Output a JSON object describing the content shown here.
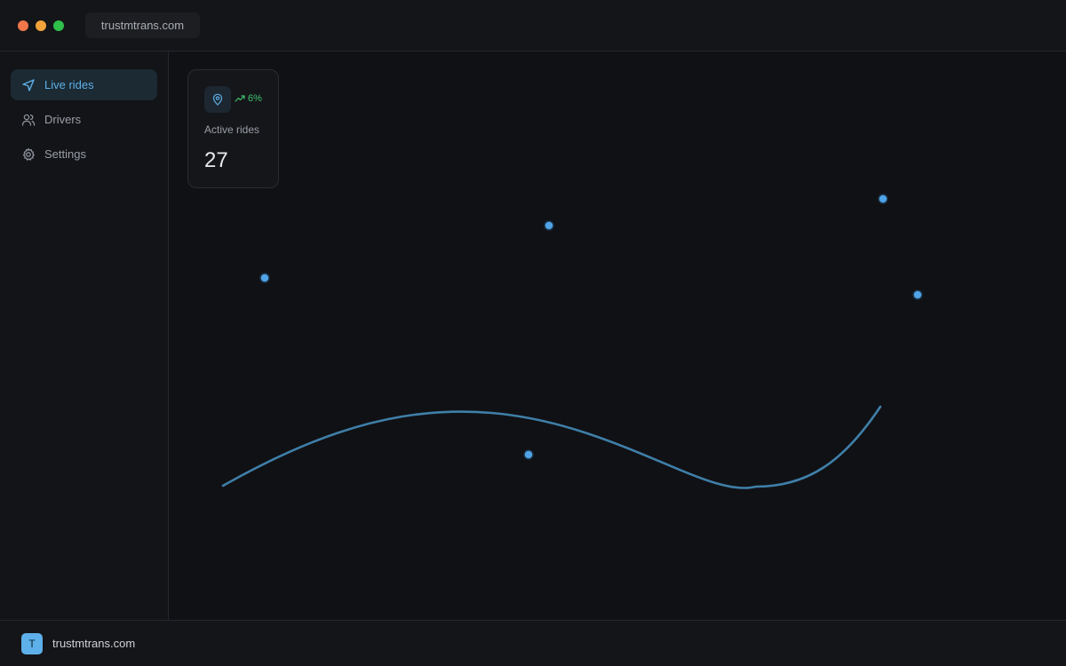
{
  "window": {
    "url": "trustmtrans.com"
  },
  "sidebar": {
    "items": [
      {
        "label": "Live rides",
        "icon": "navigation-arrow-icon",
        "active": true
      },
      {
        "label": "Drivers",
        "icon": "users-icon",
        "active": false
      },
      {
        "label": "Settings",
        "icon": "gear-icon",
        "active": false
      }
    ]
  },
  "stat_card": {
    "icon": "map-pin-icon",
    "trend": "6%",
    "trend_direction": "up",
    "label": "Active rides",
    "value": "27"
  },
  "map": {
    "route_color": "#3f7fa8",
    "marker_color": "#4fa3e6",
    "marker_count": 5
  },
  "footer": {
    "avatar_letter": "T",
    "name": "trustmtrans.com"
  },
  "colors": {
    "accent": "#5fb0e8",
    "trend_up": "#3ec46d",
    "background": "#101115"
  }
}
